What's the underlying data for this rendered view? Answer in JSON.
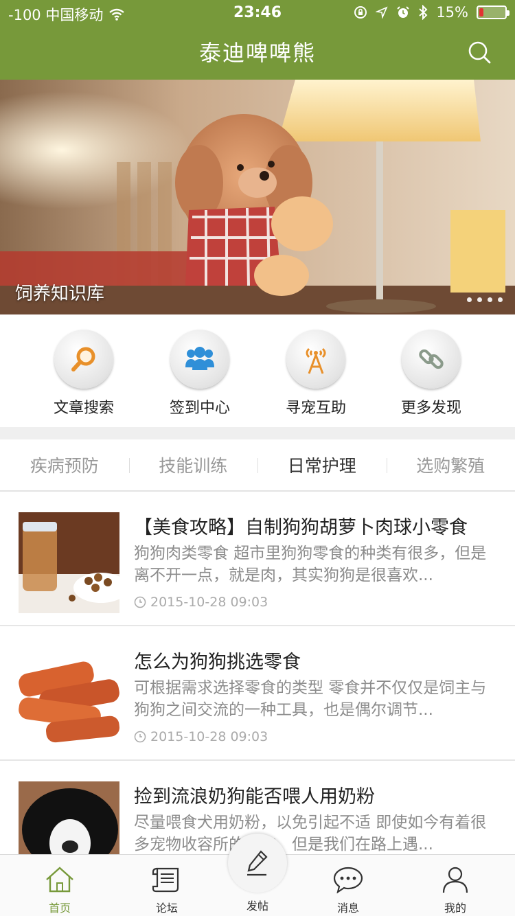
{
  "status_bar": {
    "carrier": "-100 中国移动",
    "time": "23:46",
    "battery": "15%",
    "battery_level": 0.15
  },
  "nav": {
    "title": "泰迪啤啤熊"
  },
  "banner": {
    "caption": "饲养知识库",
    "dots": 4
  },
  "quick_entries": [
    {
      "label": "文章搜索",
      "icon": "magnifier-icon"
    },
    {
      "label": "签到中心",
      "icon": "users-icon"
    },
    {
      "label": "寻宠互助",
      "icon": "signal-tower-icon"
    },
    {
      "label": "更多发现",
      "icon": "link-icon"
    }
  ],
  "tabs": [
    {
      "label": "疾病预防",
      "active": false
    },
    {
      "label": "技能训练",
      "active": false
    },
    {
      "label": "日常护理",
      "active": true
    },
    {
      "label": "选购繁殖",
      "active": false
    }
  ],
  "articles": [
    {
      "title": "【美食攻略】自制狗狗胡萝卜肉球小零食",
      "summary": "狗狗肉类零食 超市里狗狗零食的种类有很多，但是离不开一点，就是肉，其实狗狗是很喜欢...",
      "date": "2015-10-28 09:03"
    },
    {
      "title": "怎么为狗狗挑选零食",
      "summary": "可根据需求选择零食的类型 零食并不仅仅是饲主与狗狗之间交流的一种工具，也是偶尔调节...",
      "date": "2015-10-28 09:03"
    },
    {
      "title": "捡到流浪奶狗能否喂人用奶粉",
      "summary": "尽量喂食犬用奶粉，以免引起不适 即使如今有着很多宠物收容所的存在，但是我们在路上遇...",
      "date": ""
    }
  ],
  "tabbar": {
    "home": "首页",
    "forum": "论坛",
    "post": "发帖",
    "messages": "消息",
    "mine": "我的"
  },
  "colors": {
    "brand": "#77993a",
    "accent_orange": "#e8902a",
    "accent_blue": "#2f8fd8"
  }
}
